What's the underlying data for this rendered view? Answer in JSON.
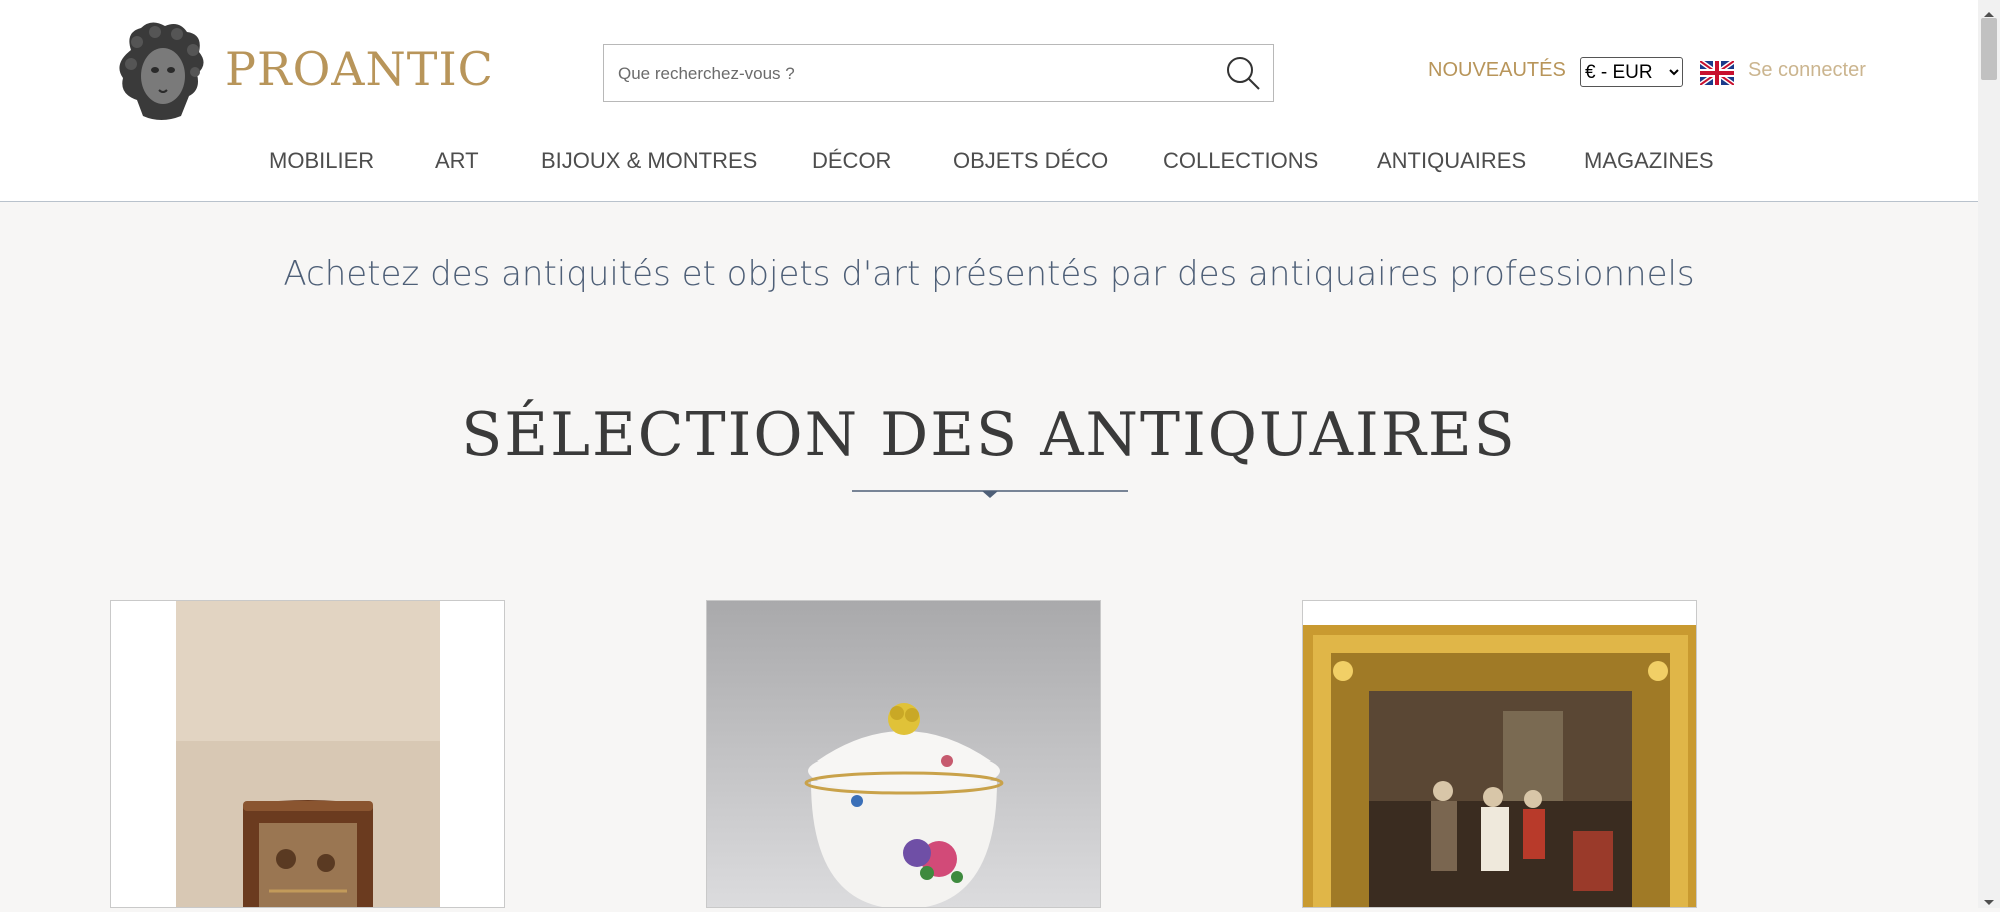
{
  "brand": {
    "name": "PROANTIC",
    "logo_icon": "cherub-head-icon",
    "color": "#b8955a"
  },
  "search": {
    "placeholder": "Que recherchez-vous ?",
    "icon": "search-icon"
  },
  "header": {
    "new_label": "NOUVEAUTÉS",
    "currency": {
      "selected": "€ - EUR",
      "options": [
        "€ - EUR"
      ]
    },
    "language_flag": "uk-flag-icon",
    "login_label": "Se connecter"
  },
  "nav": {
    "items": [
      {
        "label": "MOBILIER"
      },
      {
        "label": "ART"
      },
      {
        "label": "BIJOUX & MONTRES"
      },
      {
        "label": "DÉCOR"
      },
      {
        "label": "OBJETS DÉCO"
      },
      {
        "label": "COLLECTIONS"
      },
      {
        "label": "ANTIQUAIRES"
      },
      {
        "label": "MAGAZINES"
      }
    ]
  },
  "main": {
    "tagline": "Achetez des antiquités et objets d'art présentés par des antiquaires professionnels",
    "section_title": "SÉLECTION DES ANTIQUAIRES",
    "products": [
      {
        "image": "painted-commode-image"
      },
      {
        "image": "porcelain-sugar-bowl-image"
      },
      {
        "image": "gilt-framed-painting-image"
      }
    ]
  },
  "colors": {
    "accent": "#b8955a",
    "text_blue": "#4e5f77",
    "background": "#f7f6f5"
  }
}
